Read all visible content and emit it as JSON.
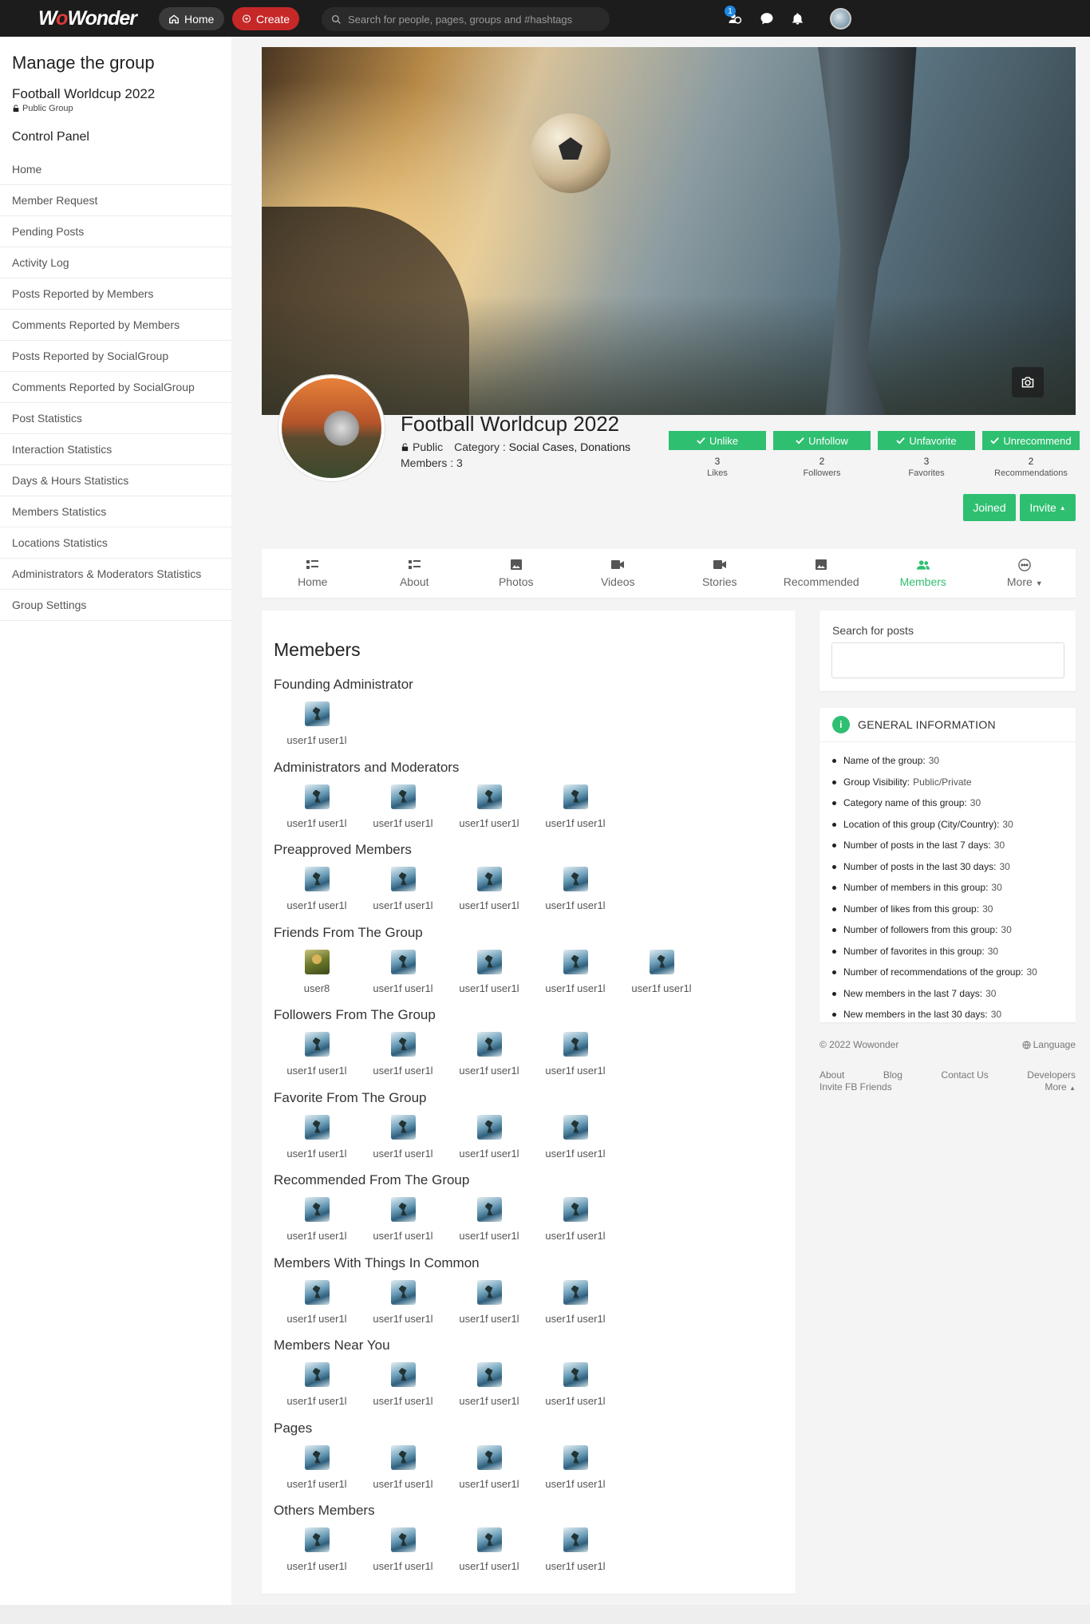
{
  "topbar": {
    "logo_pre": "W",
    "logo_o": "o",
    "logo_post": "Wonder",
    "home_label": "Home",
    "create_label": "Create",
    "search_placeholder": "Search for people, pages, groups and #hashtags",
    "notif_badge": "1",
    "icons": [
      "home-icon",
      "plus-circle-icon",
      "search-icon",
      "users-icon",
      "chat-icon",
      "bell-icon",
      "avatar"
    ]
  },
  "sidebar": {
    "title": "Manage the group",
    "group_name": "Football Worldcup 2022",
    "group_type": "Public Group",
    "control_panel": "Control Panel",
    "items": [
      "Home",
      "Member Request",
      "Pending Posts",
      "Activity Log",
      "Posts Reported by Members",
      "Comments Reported by Members",
      "Posts Reported by SocialGroup",
      "Comments Reported by SocialGroup",
      "Post Statistics",
      "Interaction Statistics",
      "Days & Hours Statistics",
      "Members Statistics",
      "Locations Statistics",
      "Administrators & Moderators Statistics",
      "Group Settings"
    ]
  },
  "group": {
    "title": "Football Worldcup 2022",
    "privacy": "Public",
    "category_label": "Category :",
    "category_value": "Social Cases, Donations",
    "members_text": "Members : 3",
    "stats": [
      {
        "button": "Unlike",
        "count": "3",
        "label": "Likes"
      },
      {
        "button": "Unfollow",
        "count": "2",
        "label": "Followers"
      },
      {
        "button": "Unfavorite",
        "count": "3",
        "label": "Favorites"
      },
      {
        "button": "Unrecommend",
        "count": "2",
        "label": "Recommendations"
      }
    ],
    "joined_label": "Joined",
    "invite_label": "Invite"
  },
  "tabs": [
    {
      "label": "Home",
      "icon": "list-icon"
    },
    {
      "label": "About",
      "icon": "list-icon"
    },
    {
      "label": "Photos",
      "icon": "image-icon"
    },
    {
      "label": "Videos",
      "icon": "video-icon"
    },
    {
      "label": "Stories",
      "icon": "video-icon"
    },
    {
      "label": "Recommended",
      "icon": "image-icon"
    },
    {
      "label": "Members",
      "icon": "users-icon",
      "active": true
    },
    {
      "label": "More",
      "icon": "more-icon"
    }
  ],
  "members_page": {
    "title": "Memebers",
    "sections": [
      {
        "title": "Founding Administrator",
        "members": [
          "user1f user1l"
        ]
      },
      {
        "title": "Administrators and Moderators",
        "members": [
          "user1f user1l",
          "user1f user1l",
          "user1f user1l",
          "user1f user1l"
        ]
      },
      {
        "title": "Preapproved Members",
        "members": [
          "user1f user1l",
          "user1f user1l",
          "user1f user1l",
          "user1f user1l"
        ]
      },
      {
        "title": "Friends From The Group",
        "members": [
          "user8",
          "user1f user1l",
          "user1f user1l",
          "user1f user1l",
          "user1f user1l"
        ]
      },
      {
        "title": "Followers From The Group",
        "members": [
          "user1f user1l",
          "user1f user1l",
          "user1f user1l",
          "user1f user1l"
        ]
      },
      {
        "title": "Favorite From The Group",
        "members": [
          "user1f user1l",
          "user1f user1l",
          "user1f user1l",
          "user1f user1l"
        ]
      },
      {
        "title": "Recommended From The Group",
        "members": [
          "user1f user1l",
          "user1f user1l",
          "user1f user1l",
          "user1f user1l"
        ]
      },
      {
        "title": "Members With Things In Common",
        "members": [
          "user1f user1l",
          "user1f user1l",
          "user1f user1l",
          "user1f user1l"
        ]
      },
      {
        "title": "Members Near You",
        "members": [
          "user1f user1l",
          "user1f user1l",
          "user1f user1l",
          "user1f user1l"
        ]
      },
      {
        "title": "Pages",
        "members": [
          "user1f user1l",
          "user1f user1l",
          "user1f user1l",
          "user1f user1l"
        ]
      },
      {
        "title": "Others Members",
        "members": [
          "user1f user1l",
          "user1f user1l",
          "user1f user1l",
          "user1f user1l"
        ]
      }
    ]
  },
  "right": {
    "search_label": "Search for posts",
    "info_title": "GENERAL INFORMATION",
    "info": [
      {
        "label": "Name of the group:",
        "value": "30"
      },
      {
        "label": "Group Visibility:",
        "value": "Public/Private"
      },
      {
        "label": "Category name of this group:",
        "value": "30"
      },
      {
        "label": "Location of this group (City/Country):",
        "value": "30"
      },
      {
        "label": "Number of posts in the last 7 days:",
        "value": "30"
      },
      {
        "label": "Number of posts in the last 30 days:",
        "value": "30"
      },
      {
        "label": "Number of members in this group:",
        "value": "30"
      },
      {
        "label": "Number of likes from this group:",
        "value": "30"
      },
      {
        "label": "Number of followers from this group:",
        "value": "30"
      },
      {
        "label": "Number of favorites in this group:",
        "value": "30"
      },
      {
        "label": "Number of recommendations of the group:",
        "value": "30"
      },
      {
        "label": "New members in the last 7 days:",
        "value": "30"
      },
      {
        "label": "New members in the last 30 days:",
        "value": "30"
      }
    ]
  },
  "footer": {
    "copyright": "© 2022 Wowonder",
    "language": "Language",
    "links": [
      "About",
      "Blog",
      "Contact Us",
      "Developers"
    ],
    "invite": "Invite FB Friends",
    "more": "More"
  },
  "colors": {
    "accent": "#2fbf71",
    "topbar": "#1c1c1c",
    "create": "#c62828",
    "badge": "#1e88e5"
  }
}
